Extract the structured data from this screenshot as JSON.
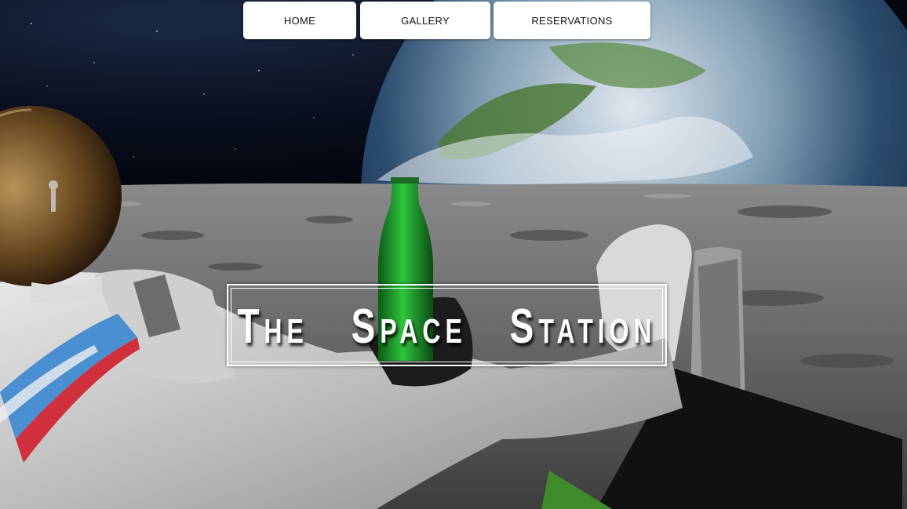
{
  "nav": {
    "items": [
      {
        "label": "HOME"
      },
      {
        "label": "GALLERY"
      },
      {
        "label": "RESERVATIONS"
      }
    ]
  },
  "hero": {
    "title": "The Space Station",
    "image_description_icon": "astronaut-on-moon-image"
  },
  "colors": {
    "nav_bg": "#ffffff",
    "nav_text": "#111111",
    "title_text": "#ffffff",
    "frame": "#ffffff"
  }
}
